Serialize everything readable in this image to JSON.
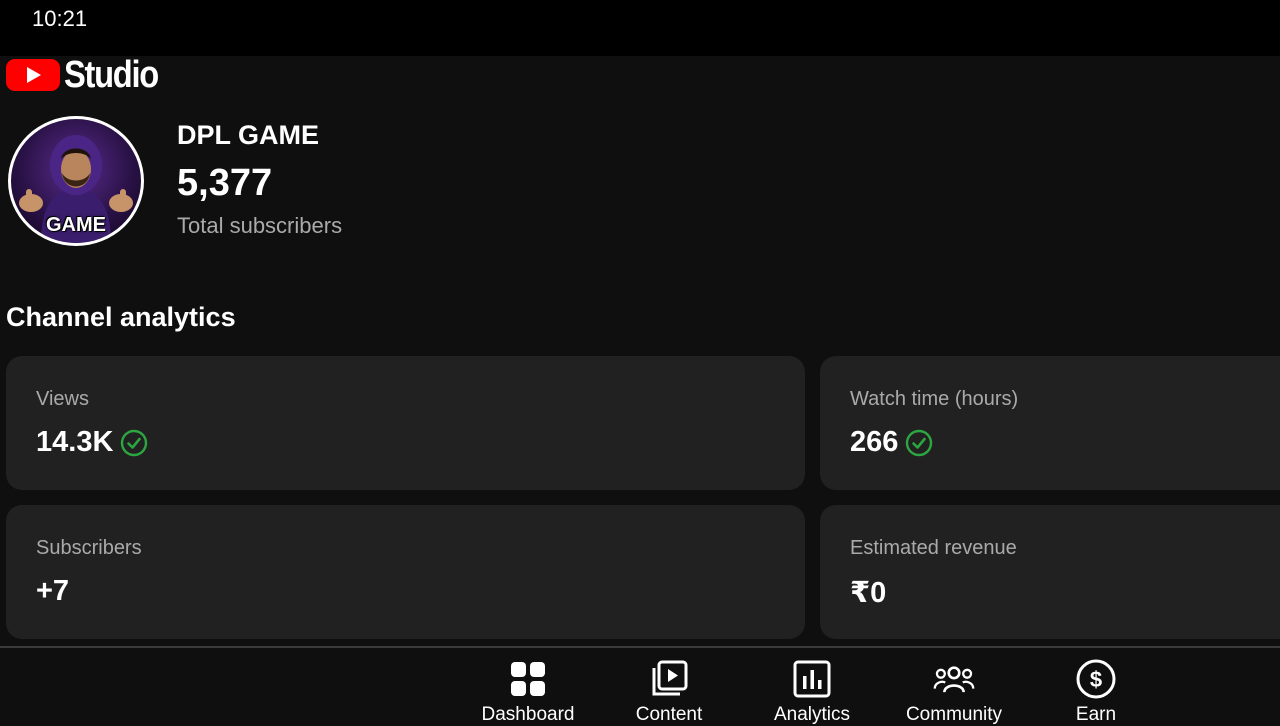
{
  "status_bar": {
    "time": "10:21"
  },
  "header": {
    "app_name": "Studio",
    "logo_icon": "youtube-play-icon",
    "brand_color": "#ff0000"
  },
  "channel": {
    "avatar_caption": "GAME",
    "name": "DPL GAME",
    "subscriber_count": "5,377",
    "subscriber_label": "Total subscribers"
  },
  "analytics": {
    "title": "Channel analytics",
    "cards": [
      {
        "label": "Views",
        "value": "14.3K",
        "check": true
      },
      {
        "label": "Watch time (hours)",
        "value": "266",
        "check": true
      },
      {
        "label": "Subscribers",
        "value": "+7",
        "check": false
      },
      {
        "label": "Estimated revenue",
        "value": "₹0",
        "check": false
      }
    ],
    "check_color": "#2ba640"
  },
  "bottom_nav": {
    "items": [
      {
        "label": "Dashboard",
        "icon": "dashboard-icon"
      },
      {
        "label": "Content",
        "icon": "content-icon"
      },
      {
        "label": "Analytics",
        "icon": "analytics-icon"
      },
      {
        "label": "Community",
        "icon": "community-icon"
      },
      {
        "label": "Earn",
        "icon": "earn-icon"
      }
    ]
  }
}
